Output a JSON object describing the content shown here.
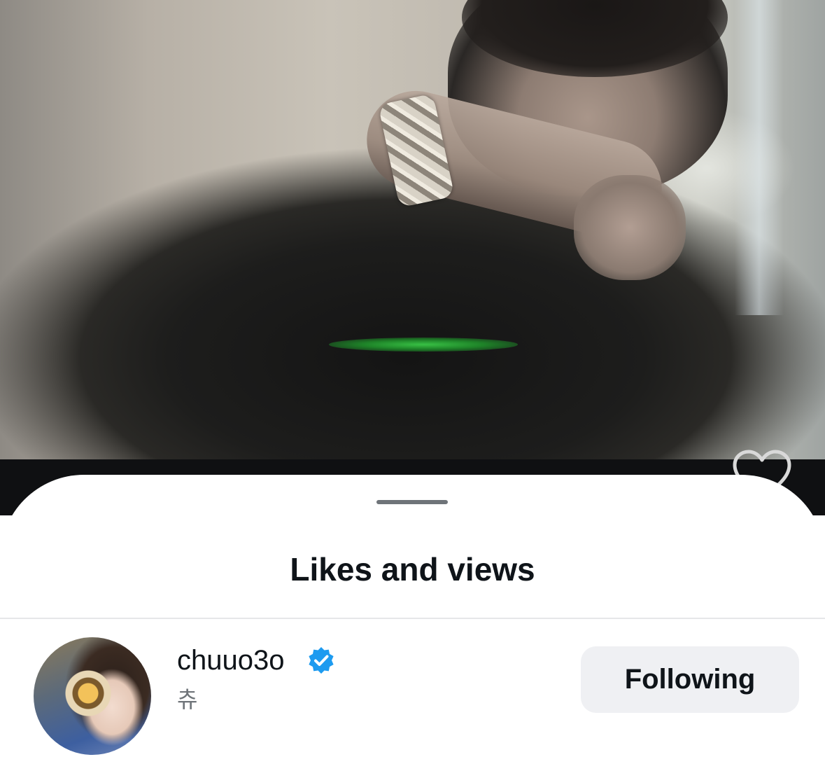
{
  "sheet": {
    "title": "Likes and views"
  },
  "user": {
    "username": "chuuo3o",
    "display_name": "츄",
    "verified": true,
    "follow_label": "Following"
  },
  "icons": {
    "like": "heart-icon",
    "verified": "verified-badge-icon"
  },
  "colors": {
    "verified_badge": "#1d9bf0",
    "button_bg": "#eff0f3",
    "text_primary": "#0f1419",
    "text_secondary": "#6f7479"
  }
}
